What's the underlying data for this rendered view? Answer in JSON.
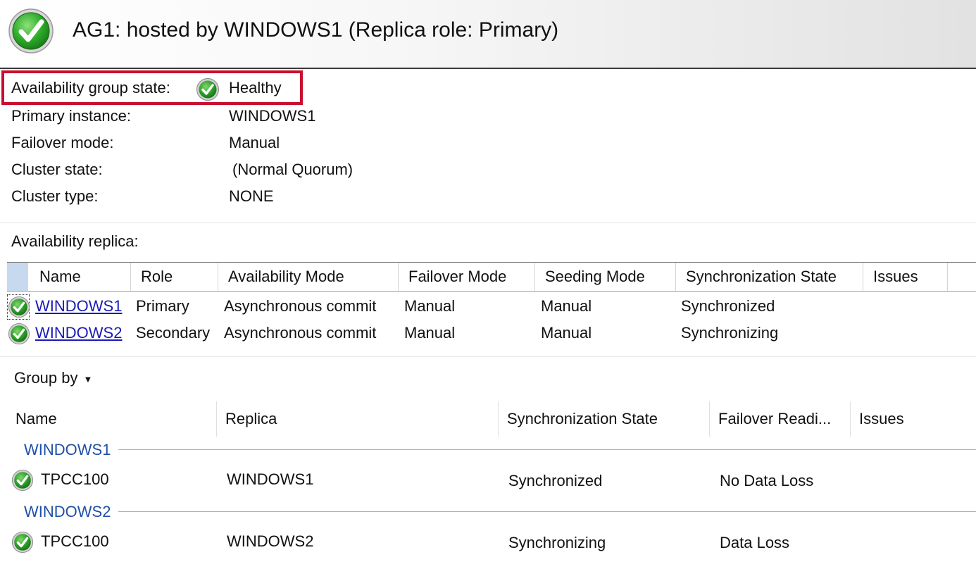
{
  "header": {
    "title": "AG1: hosted by WINDOWS1 (Replica role: Primary)",
    "status_icon": "check-circle-icon"
  },
  "summary": {
    "state_label": "Availability group state:",
    "state_value": "Healthy",
    "primary_label": "Primary instance:",
    "primary_value": "WINDOWS1",
    "failover_label": "Failover mode:",
    "failover_value": "Manual",
    "cluster_state_label": "Cluster state:",
    "cluster_state_value": "(Normal Quorum)",
    "cluster_type_label": "Cluster type:",
    "cluster_type_value": "NONE",
    "highlight_color": "#c8102e"
  },
  "replicas": {
    "section_label": "Availability replica:",
    "columns": [
      "Name",
      "Role",
      "Availability Mode",
      "Failover Mode",
      "Seeding Mode",
      "Synchronization State",
      "Issues"
    ],
    "rows": [
      {
        "name": "WINDOWS1",
        "role": "Primary",
        "availability_mode": "Asynchronous commit",
        "failover_mode": "Manual",
        "seeding_mode": "Manual",
        "sync_state": "Synchronized"
      },
      {
        "name": "WINDOWS2",
        "role": "Secondary",
        "availability_mode": "Asynchronous commit",
        "failover_mode": "Manual",
        "seeding_mode": "Manual",
        "sync_state": "Synchronizing"
      }
    ]
  },
  "databases": {
    "group_by_label": "Group by",
    "columns": [
      "Name",
      "Replica",
      "Synchronization State",
      "Failover Readi...",
      "Issues"
    ],
    "groups": [
      {
        "name": "WINDOWS1",
        "rows": [
          {
            "name": "TPCC100",
            "replica": "WINDOWS1",
            "sync_state": "Synchronized",
            "failover_readiness": "No Data Loss"
          }
        ]
      },
      {
        "name": "WINDOWS2",
        "rows": [
          {
            "name": "TPCC100",
            "replica": "WINDOWS2",
            "sync_state": "Synchronizing",
            "failover_readiness": "Data Loss"
          }
        ]
      }
    ]
  },
  "colors": {
    "healthy_green": "#1e9a1e",
    "link_blue": "#1a1ab8",
    "group_blue": "#1f4fa8"
  }
}
